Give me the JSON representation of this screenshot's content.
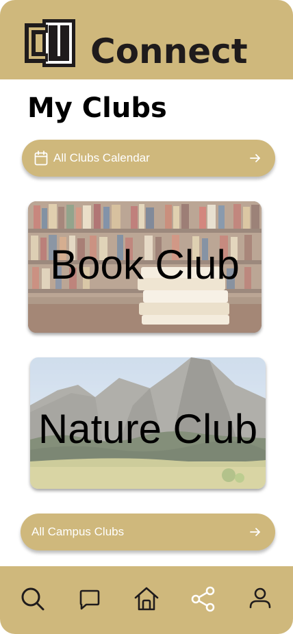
{
  "header": {
    "logo_icon": "cu-monogram-logo",
    "app_title": "Connect"
  },
  "page": {
    "title": "My Clubs"
  },
  "calendar_button": {
    "icon": "calendar-icon",
    "label": "All Clubs Calendar",
    "trailing_icon": "arrow-right-icon"
  },
  "clubs": [
    {
      "name": "Book Club",
      "image": "bookshelf-stack-photo"
    },
    {
      "name": "Nature Club",
      "image": "flatirons-mountain-photo"
    }
  ],
  "campus_button": {
    "label": "All Campus Clubs",
    "trailing_icon": "arrow-right-icon"
  },
  "bottom_nav": {
    "items": [
      {
        "icon": "search-icon"
      },
      {
        "icon": "chat-icon"
      },
      {
        "icon": "home-icon"
      },
      {
        "icon": "share-icon"
      },
      {
        "icon": "profile-icon"
      }
    ]
  },
  "colors": {
    "gold": "#cfb87c",
    "dark": "#1f1b1c",
    "white": "#ffffff"
  }
}
